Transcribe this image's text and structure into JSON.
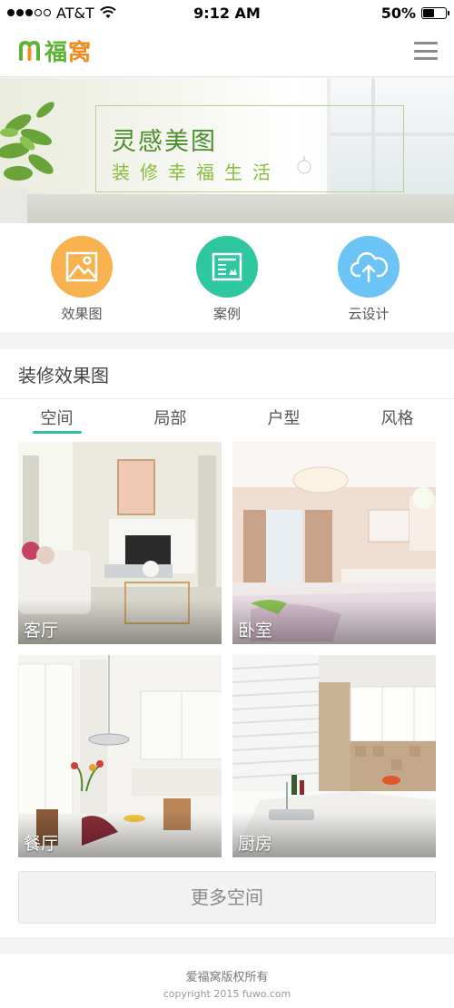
{
  "status_bar": {
    "carrier": "AT&T",
    "time": "9:12 AM",
    "battery": "50%",
    "battery_level": 0.5
  },
  "header": {
    "logo_text_1": "福",
    "logo_text_2": "窝",
    "brand_colors": {
      "green": "#5cb531",
      "orange": "#f28a1c"
    }
  },
  "banner": {
    "title": "灵感美图",
    "subtitle": "装修幸福生活"
  },
  "quick_links": [
    {
      "label": "效果图",
      "icon": "picture-icon",
      "color": "#f8b14f"
    },
    {
      "label": "案例",
      "icon": "document-icon",
      "color": "#2ec79f"
    },
    {
      "label": "云设计",
      "icon": "cloud-upload-icon",
      "color": "#6cc3f5"
    }
  ],
  "section": {
    "title": "装修效果图",
    "tabs": [
      "空间",
      "局部",
      "户型",
      "风格"
    ],
    "active_tab": "空间",
    "cards": [
      {
        "label": "客厅"
      },
      {
        "label": "卧室"
      },
      {
        "label": "餐厅"
      },
      {
        "label": "厨房"
      }
    ],
    "more_label": "更多空间",
    "accent": "#2bbfa0"
  },
  "footer": {
    "line1": "爱福窝版权所有",
    "line2": "copyright 2015 fuwo.com"
  }
}
